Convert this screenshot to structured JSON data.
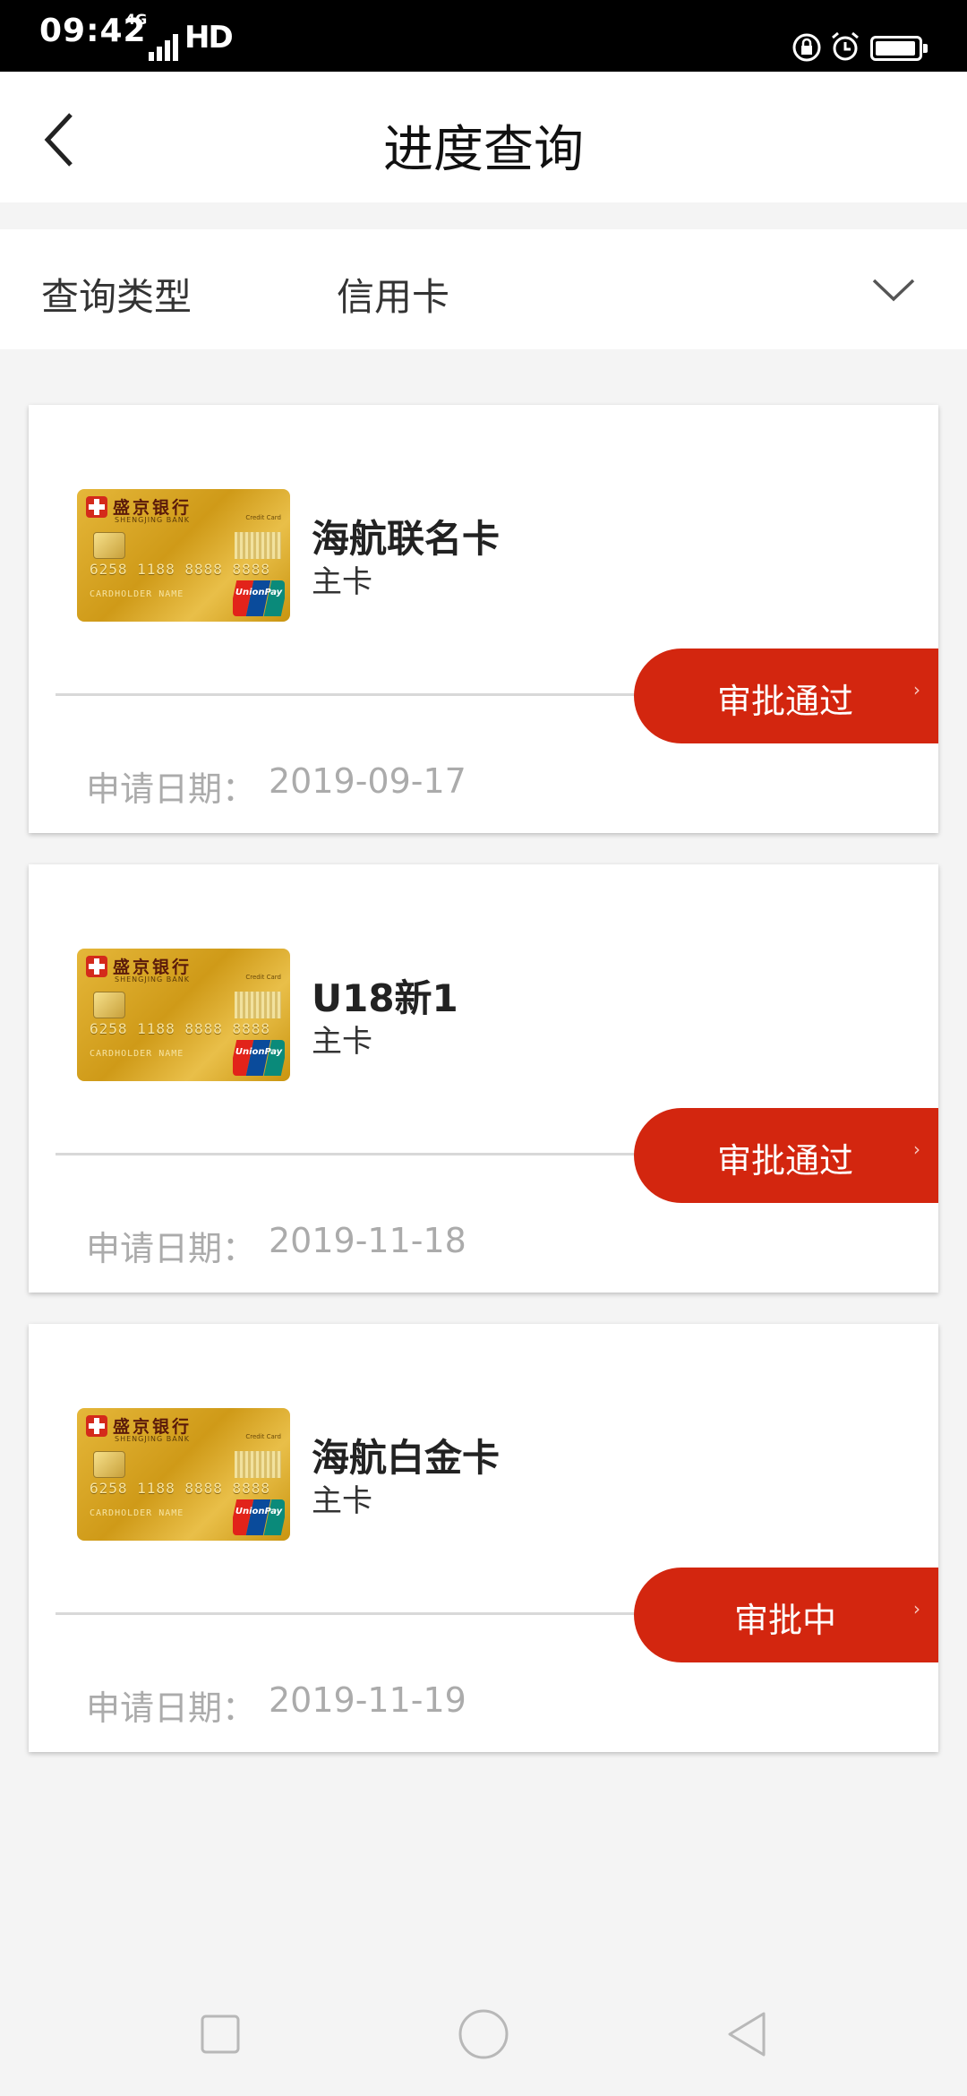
{
  "status_bar": {
    "time": "09:42",
    "network": "4G",
    "hd": "HD"
  },
  "header": {
    "title": "进度查询"
  },
  "filter": {
    "label": "查询类型",
    "value": "信用卡"
  },
  "bank_card_face": {
    "bank_name": "盛京银行",
    "bank_name_en": "SHENGJING BANK",
    "credit_card": "Credit Card",
    "number": "6258 1188 8888 8888",
    "holder": "CARDHOLDER NAME",
    "unionpay": "UnionPay"
  },
  "applications": [
    {
      "card_name": "海航联名卡",
      "card_type": "主卡",
      "status": "审批通过",
      "date_label": "申请日期：",
      "date": "2019-09-17"
    },
    {
      "card_name": "U18新1",
      "card_type": "主卡",
      "status": "审批通过",
      "date_label": "申请日期：",
      "date": "2019-11-18"
    },
    {
      "card_name": "海航白金卡",
      "card_type": "主卡",
      "status": "审批中",
      "date_label": "申请日期：",
      "date": "2019-11-19"
    }
  ],
  "colors": {
    "accent": "#d3260f",
    "background": "#f4f4f4",
    "muted_text": "#ababab"
  },
  "icons": {
    "back": "chevron-left-icon",
    "dropdown": "chevron-down-icon",
    "status_arrow": "chevron-right-icon",
    "nav_recents": "square-icon",
    "nav_home": "circle-icon",
    "nav_back": "triangle-back-icon"
  }
}
